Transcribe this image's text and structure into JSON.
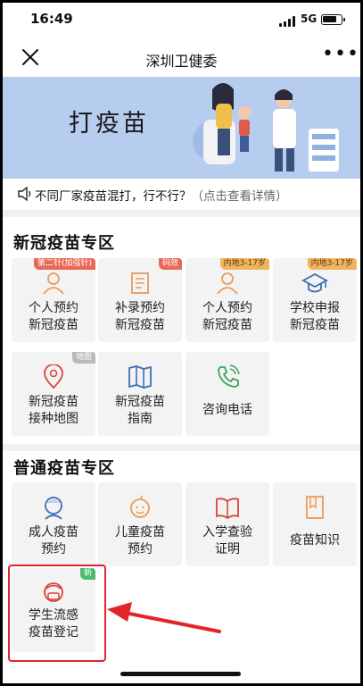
{
  "status": {
    "time": "16:49",
    "network": "5G",
    "battery_level": 0.85
  },
  "nav": {
    "title": "深圳卫健委"
  },
  "banner": {
    "title": "打疫苗"
  },
  "notice": {
    "text": "不同厂家疫苗混打，行不行？",
    "link": "（点击查看详情）"
  },
  "covid_section": {
    "title": "新冠疫苗专区",
    "items": [
      {
        "label": "个人预约\n新冠疫苗",
        "badge": "第二针(加强针)",
        "icon": "person-icon"
      },
      {
        "label": "补录预约\n新冠疫苗",
        "badge": "码效",
        "icon": "form-icon"
      },
      {
        "label": "个人预约\n新冠疫苗",
        "badge": "内地3-17岁",
        "icon": "person-icon"
      },
      {
        "label": "学校申报\n新冠疫苗",
        "badge": "内地3-17岁",
        "icon": "graduation-cap-icon"
      },
      {
        "label": "新冠疫苗\n接种地图",
        "badge": "地图",
        "icon": "map-pin-icon"
      },
      {
        "label": "新冠疫苗\n指南",
        "icon": "map-book-icon"
      },
      {
        "label": "咨询电话",
        "icon": "phone-icon"
      }
    ]
  },
  "general_section": {
    "title": "普通疫苗专区",
    "items": [
      {
        "label": "成人疫苗\n预约",
        "icon": "adult-icon"
      },
      {
        "label": "儿童疫苗\n预约",
        "icon": "baby-icon"
      },
      {
        "label": "入学查验\n证明",
        "icon": "open-book-icon"
      },
      {
        "label": "疫苗知识",
        "icon": "booklet-icon"
      },
      {
        "label": "学生流感\n疫苗登记",
        "badge": "新",
        "icon": "student-mask-icon"
      }
    ]
  },
  "colors": {
    "icon_orange": "#ed9a55",
    "icon_blue": "#3d6fb6",
    "icon_green": "#3aa35b",
    "icon_red": "#d9453d",
    "highlight": "#e3242b"
  }
}
